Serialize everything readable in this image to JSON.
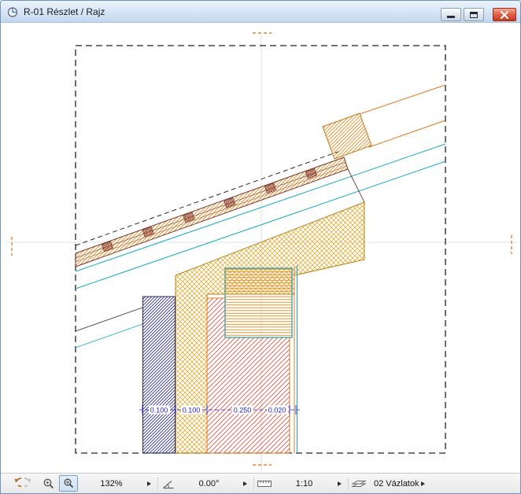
{
  "window": {
    "title": "R-01 Részlet / Rajz"
  },
  "drawing": {
    "dimension_labels": [
      "0.100",
      "0.100",
      "0.250",
      "0.020"
    ]
  },
  "statusbar": {
    "zoom": "132%",
    "rotation": "0.00°",
    "scale": "1:10",
    "layer": "02 Vázlatok"
  },
  "colors": {
    "insulation_crosshatch": "#e0a018",
    "roof_hatch_orange": "#e08818",
    "masonry_red_hatch": "#d05040",
    "plaster_navy_hatch": "#303080",
    "membrane_cyan": "#18a8c8",
    "sheathing_brown": "#7a3428",
    "outline_orange": "#e07820",
    "dimension_blue": "#2222cc",
    "marker_orange": "#f08030",
    "close_button_red": "#c93a22",
    "titlebar_blue": "#c2d7ee"
  }
}
